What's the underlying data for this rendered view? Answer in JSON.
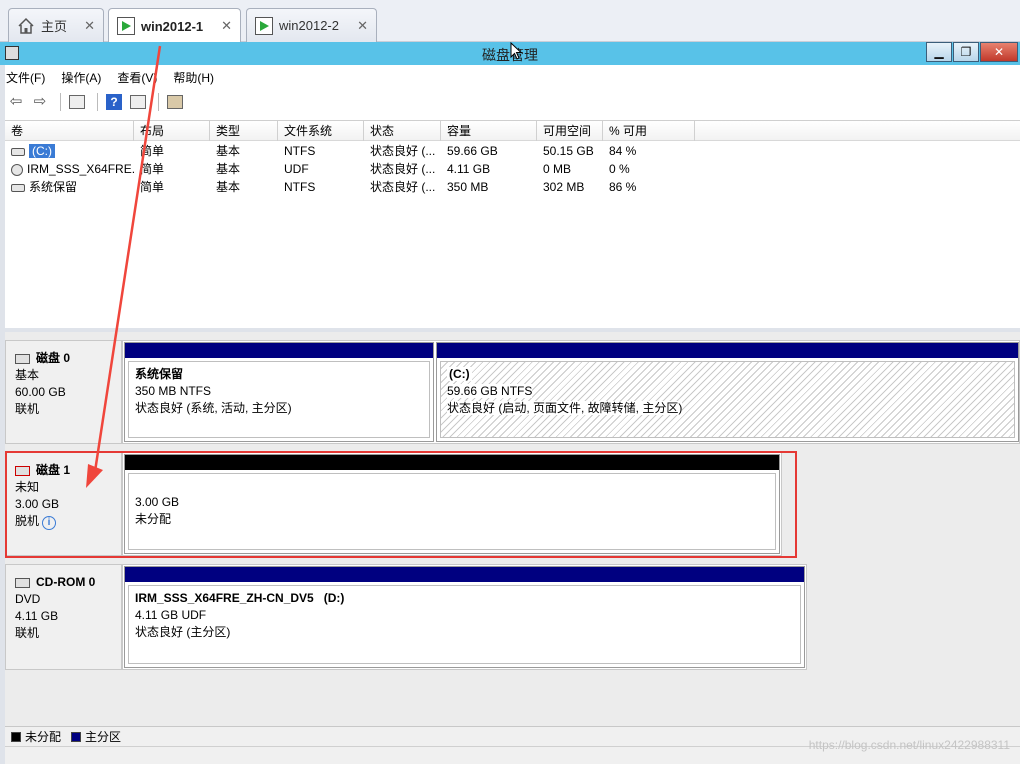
{
  "tabs": [
    {
      "label": "主页",
      "icon": "home-icon"
    },
    {
      "label": "win2012-1",
      "icon": "vm-icon"
    },
    {
      "label": "win2012-2",
      "icon": "vm-icon"
    }
  ],
  "tab_close_glyph": "✕",
  "window": {
    "title": "磁盘管理"
  },
  "menu": [
    "文件(F)",
    "操作(A)",
    "查看(V)",
    "帮助(H)"
  ],
  "table": {
    "columns": [
      "卷",
      "布局",
      "类型",
      "文件系统",
      "状态",
      "容量",
      "可用空间",
      "% 可用"
    ],
    "rows": [
      {
        "volume": "(C:)",
        "layout": "简单",
        "type": "基本",
        "fs": "NTFS",
        "status": "状态良好 (...",
        "capacity": "59.66 GB",
        "free": "50.15 GB",
        "pct": "84 %"
      },
      {
        "volume": "IRM_SSS_X64FRE...",
        "layout": "简单",
        "type": "基本",
        "fs": "UDF",
        "status": "状态良好 (...",
        "capacity": "4.11 GB",
        "free": "0 MB",
        "pct": "0 %"
      },
      {
        "volume": "系统保留",
        "layout": "简单",
        "type": "基本",
        "fs": "NTFS",
        "status": "状态良好 (...",
        "capacity": "350 MB",
        "free": "302 MB",
        "pct": "86 %"
      }
    ]
  },
  "disks": {
    "disk0": {
      "name": "磁盘 0",
      "kind": "基本",
      "size": "60.00 GB",
      "state": "联机",
      "partitions": [
        {
          "name": "系统保留",
          "size_fs": "350 MB NTFS",
          "status": "状态良好 (系统, 活动, 主分区)"
        },
        {
          "name": "(C:)",
          "size_fs": "59.66 GB NTFS",
          "status": "状态良好 (启动, 页面文件, 故障转储, 主分区)"
        }
      ]
    },
    "disk1": {
      "name": "磁盘 1",
      "kind": "未知",
      "size": "3.00 GB",
      "state": "脱机",
      "partition": {
        "size": "3.00 GB",
        "status": "未分配"
      }
    },
    "cdrom0": {
      "name": "CD-ROM 0",
      "kind": "DVD",
      "size": "4.11 GB",
      "state": "联机",
      "partition": {
        "name": "IRM_SSS_X64FRE_ZH-CN_DV5   (D:)",
        "size_fs": "4.11 GB UDF",
        "status": "状态良好 (主分区)"
      }
    }
  },
  "legend": [
    {
      "label": "未分配",
      "color": "#000000"
    },
    {
      "label": "主分区",
      "color": "#000080"
    }
  ],
  "watermark": "https://blog.csdn.net/linux2422988311",
  "colors": {
    "titlebar": "#58c2e8",
    "primary_partition": "#000080",
    "unallocated": "#000000",
    "highlight": "#e53935"
  }
}
